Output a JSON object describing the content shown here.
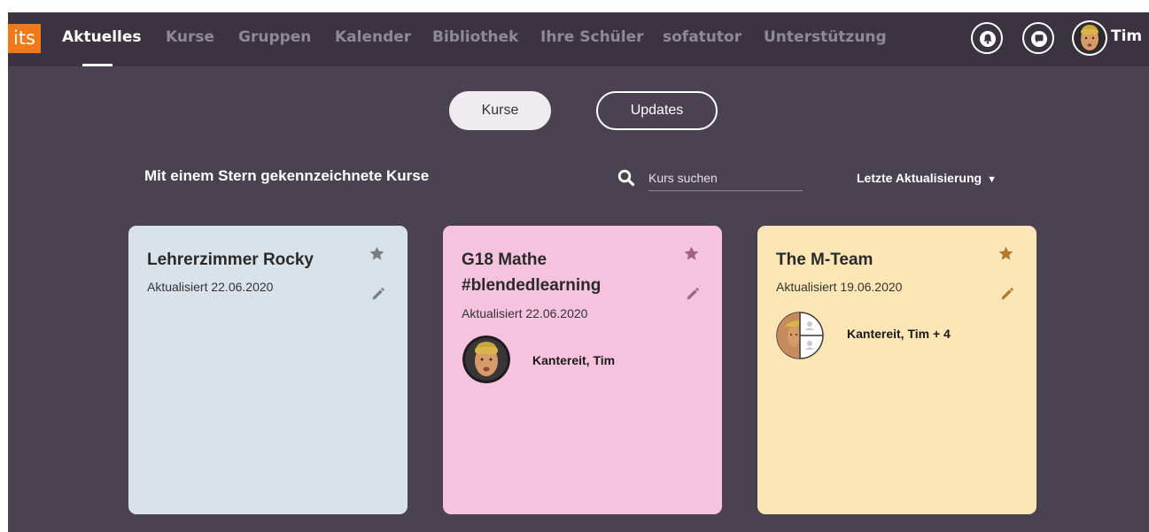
{
  "logo": {
    "text": "its",
    "color": "#f07a1a"
  },
  "nav": {
    "items": [
      {
        "label": "Aktuelles",
        "active": true
      },
      {
        "label": "Kurse",
        "active": false
      },
      {
        "label": "Gruppen",
        "active": false
      },
      {
        "label": "Kalender",
        "active": false
      },
      {
        "label": "Bibliothek",
        "active": false
      },
      {
        "label": "Ihre Schüler",
        "active": false
      },
      {
        "label": "sofatutor",
        "active": false
      },
      {
        "label": "Unterstützung",
        "active": false
      }
    ],
    "notification_icon": "bell-icon",
    "messages_icon": "chat-bubble-icon",
    "user_name": "Tim"
  },
  "toggles": {
    "kurse": "Kurse",
    "updates": "Updates",
    "selected": "Kurse"
  },
  "section_title": "Mit einem Stern gekennzeichnete Kurse",
  "search": {
    "placeholder": "Kurs suchen",
    "icon": "search-icon"
  },
  "sort": {
    "label": "Letzte Aktualisierung",
    "icon": "caret-down-icon"
  },
  "cards": [
    {
      "title": "Lehrerzimmer Rocky",
      "date": "Aktualisiert 22.06.2020",
      "bg": "#d9e2e9",
      "star_color": "#7a7d82",
      "edit_color": "#7a7d82",
      "members": null
    },
    {
      "title": "G18 Mathe #blendedlearning",
      "date": "Aktualisiert 22.06.2020",
      "bg": "#f5c3dd",
      "star_color": "#a0607e",
      "edit_color": "#a0607e",
      "members": {
        "name": "Kantereit, Tim"
      }
    },
    {
      "title": "The M-Team",
      "date": "Aktualisiert 19.06.2020",
      "bg": "#fde6b6",
      "star_color": "#b07a35",
      "edit_color": "#b07a35",
      "members": {
        "name": "Kantereit, Tim  + 4"
      }
    }
  ],
  "colors": {
    "background": "#4a4250",
    "navbar": "#3b3440",
    "nav_inactive": "#8f8896"
  }
}
